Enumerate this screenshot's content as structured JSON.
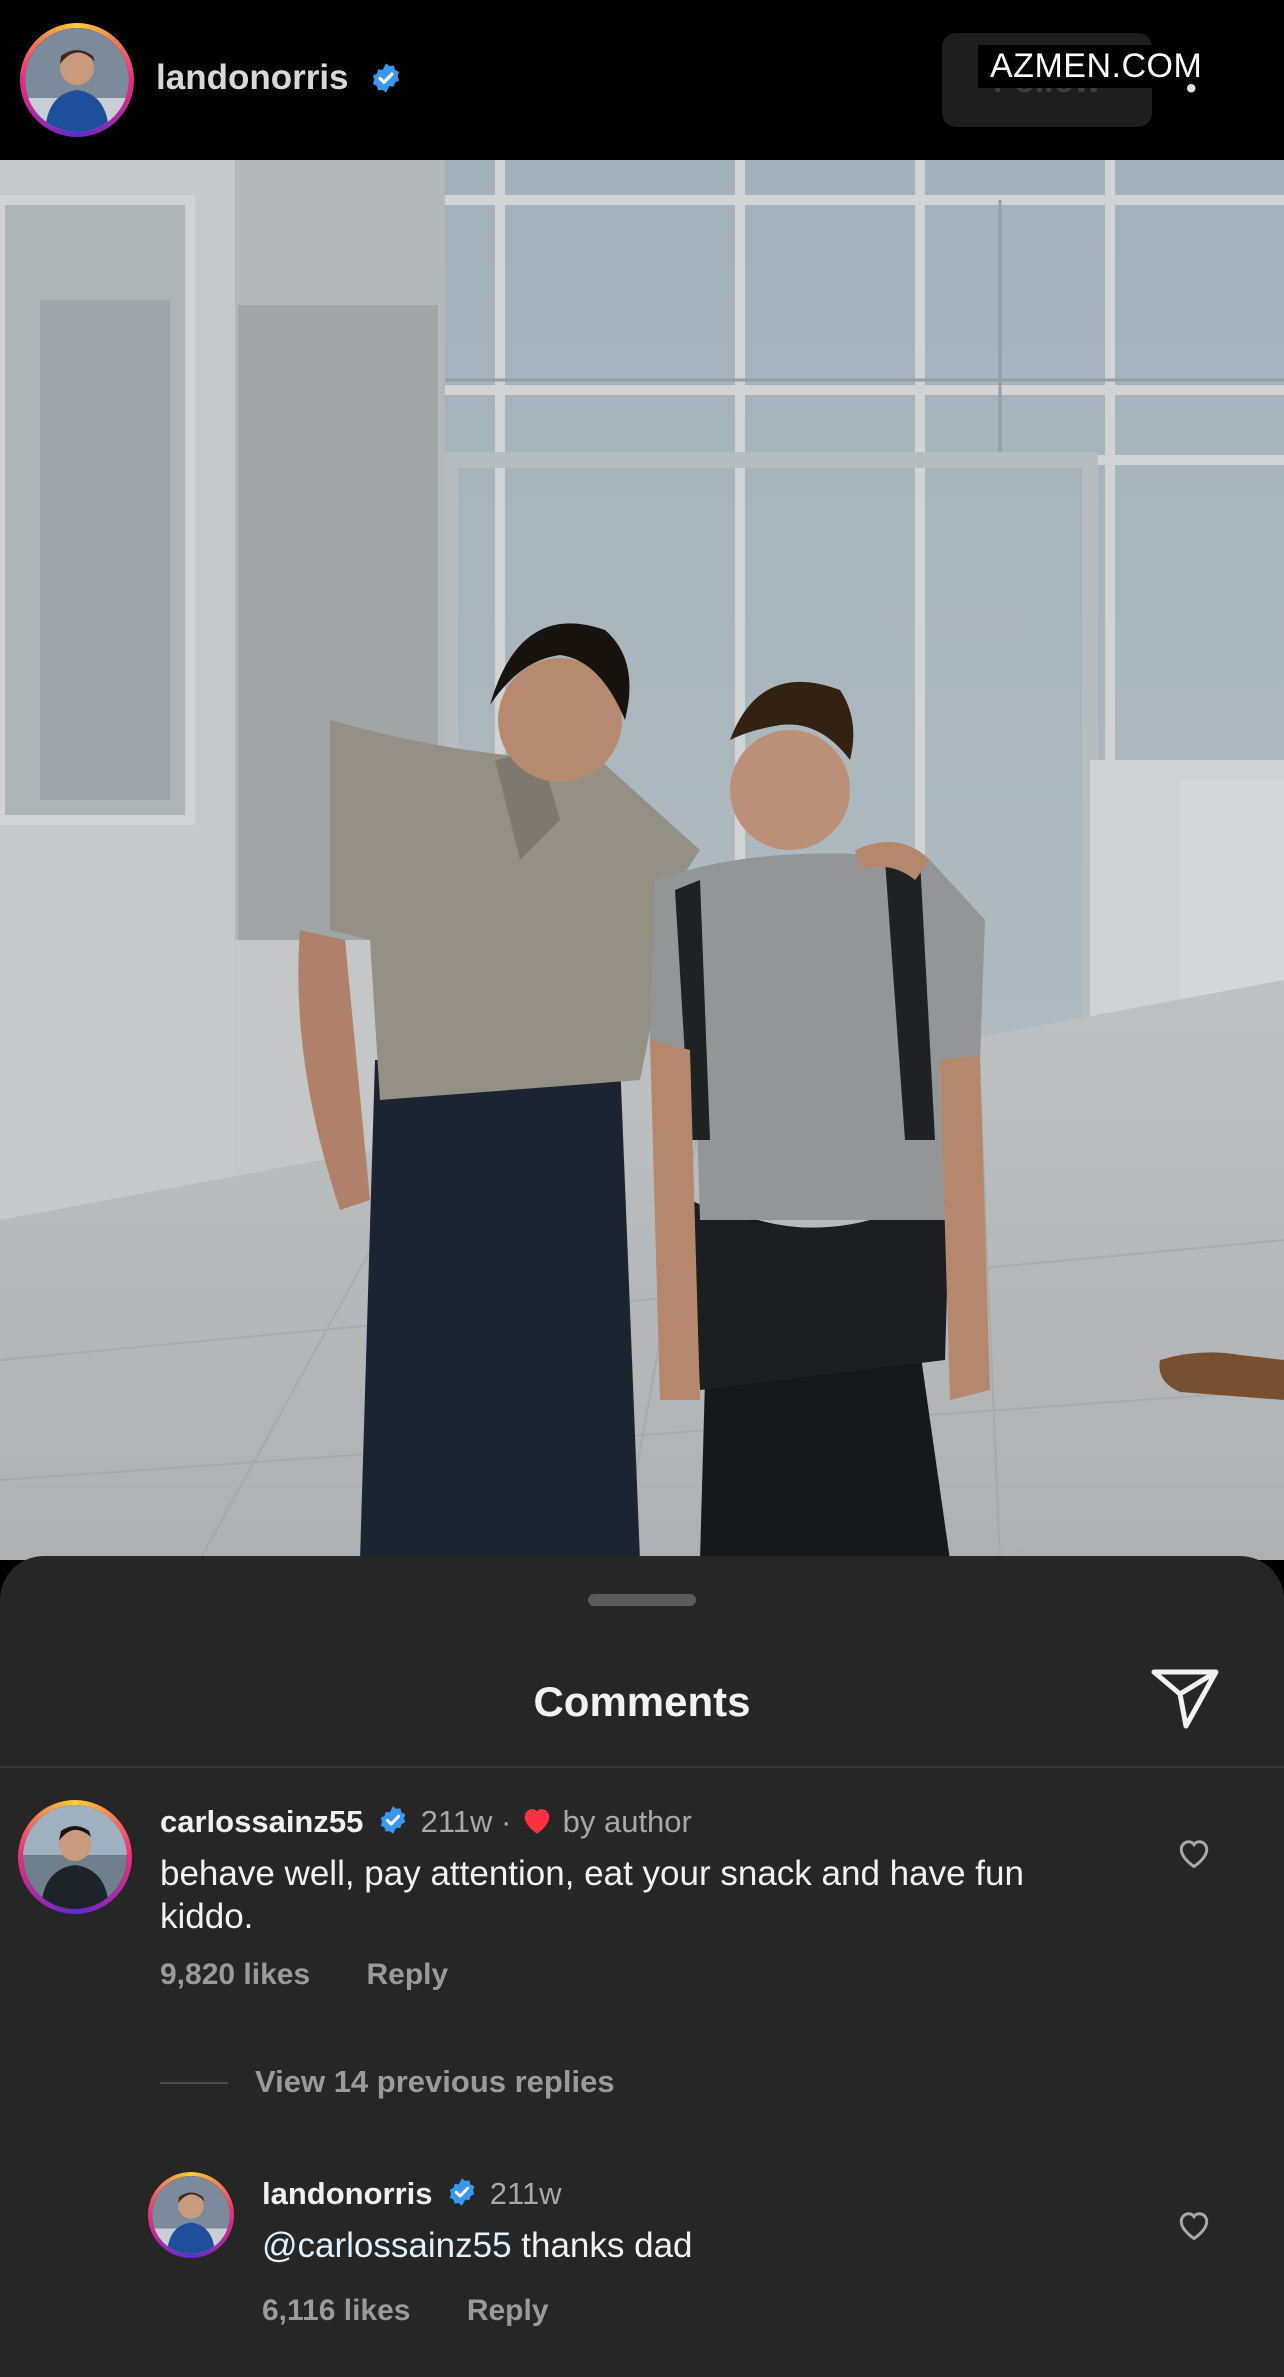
{
  "header": {
    "username": "landonorris",
    "follow_label": "Follow",
    "watermark": "AZMEN.COM"
  },
  "sheet": {
    "title": "Comments"
  },
  "comments": [
    {
      "username": "carlossainz55",
      "time": "211w",
      "by_author": "by author",
      "text": "behave well, pay attention, eat your snack and have fun kiddo.",
      "likes": "9,820 likes",
      "reply_label": "Reply"
    }
  ],
  "view_replies": "View 14 previous replies",
  "reply": {
    "username": "landonorris",
    "time": "211w",
    "mention": "@carlossainz55",
    "text": " thanks dad",
    "likes": "6,116 likes",
    "reply_label": "Reply"
  },
  "colors": {
    "verified": "#3897f0",
    "heart": "#ff3040",
    "sheet_bg": "#262626"
  }
}
